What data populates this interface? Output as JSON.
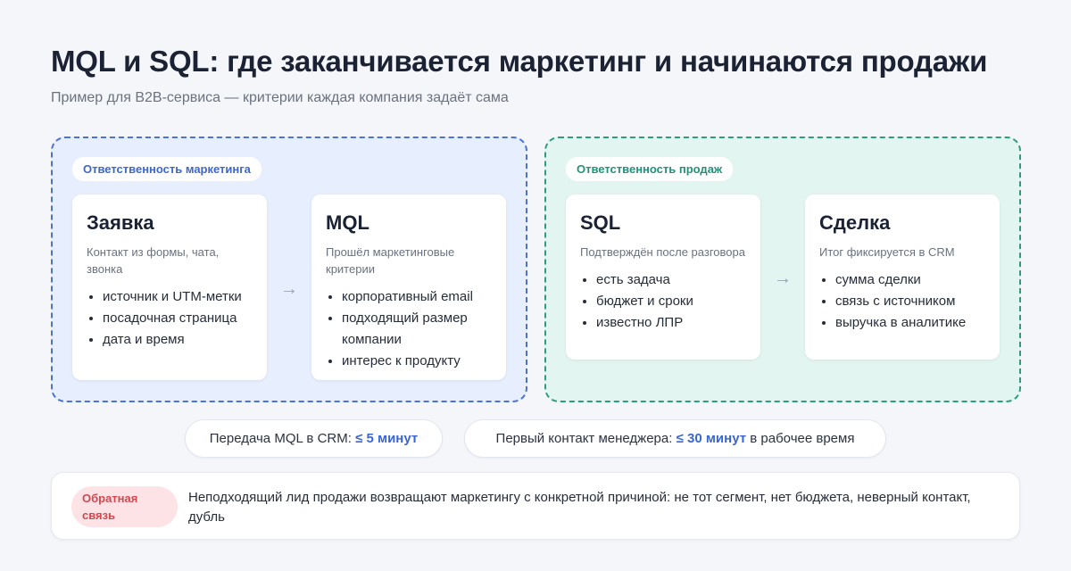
{
  "header": {
    "title": "MQL и SQL: где заканчивается маркетинг и начинаются продажи",
    "subtitle": "Пример для B2B-сервиса — критерии каждая компания задаёт сама"
  },
  "marketing": {
    "badge": "Ответственность маркетинга",
    "color": "#4b73d6",
    "cards": [
      {
        "title": "Заявка",
        "desc": "Контакт из формы, чата, звонка",
        "items": [
          "источник и UTM-метки",
          "посадочная страница",
          "дата и время"
        ]
      },
      {
        "title": "MQL",
        "desc": "Прошёл маркетинговые критерии",
        "items": [
          "корпоративный email",
          "подходящий размер компании",
          "интерес к продукту"
        ]
      }
    ]
  },
  "sales": {
    "badge": "Ответственность продаж",
    "color": "#2f9c80",
    "cards": [
      {
        "title": "SQL",
        "desc": "Подтверждён после разговора",
        "items": [
          "есть задача",
          "бюджет и сроки",
          "известно ЛПР"
        ]
      },
      {
        "title": "Сделка",
        "desc": "Итог фиксируется в CRM",
        "items": [
          "сумма сделки",
          "связь с источником",
          "выручка в аналитике"
        ]
      }
    ]
  },
  "arrow_glyph": "→",
  "sla": [
    {
      "label": "Передача MQL в CRM:",
      "value": "≤ 5 минут",
      "suffix": ""
    },
    {
      "label": "Первый контакт менеджера:",
      "value": "≤ 30 минут",
      "suffix": "в рабочее время"
    }
  ],
  "feedback": {
    "badge": "Обратная связь",
    "text": "Неподходящий лид продажи возвращают маркетингу с конкретной причиной: не тот сегмент, нет бюджета, неверный контакт, дубль"
  }
}
